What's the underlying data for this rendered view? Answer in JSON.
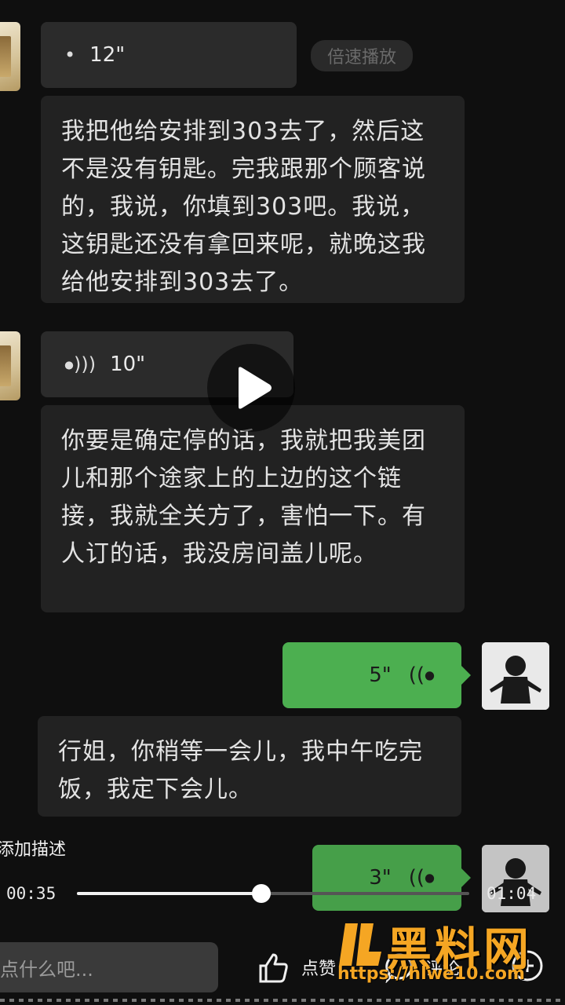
{
  "messages": {
    "m1": {
      "duration": "12\"",
      "speed_label": "倍速播放",
      "transcript": "我把他给安排到303去了，然后这不是没有钥匙。完我跟那个顾客说的，我说，你填到303吧。我说，这钥匙还没有拿回来呢，就晚这我给他安排到303去了。"
    },
    "m2": {
      "duration": "10\"",
      "transcript": "你要是确定停的话，我就把我美团儿和那个途家上的上边的这个链接，我就全关方了，害怕一下。有人订的话，我没房间盖儿呢。"
    },
    "m3": {
      "duration": "5\"",
      "transcript": "行姐，你稍等一会儿，我中午吃完饭，我定下会儿。"
    },
    "m4": {
      "duration": "3\""
    }
  },
  "player": {
    "description_placeholder": "添加描述",
    "current_time": "00:35",
    "total_time": "01:04",
    "progress": 0.47
  },
  "bottom_bar": {
    "comment_placeholder": "点什么吧...",
    "like_label": "点赞",
    "comment_label": "评论"
  },
  "watermark": {
    "brand": "黑料网",
    "url": "https://hlwe10.com"
  },
  "colors": {
    "accent_green": "#4caf50",
    "brand_orange": "#f5a623"
  }
}
